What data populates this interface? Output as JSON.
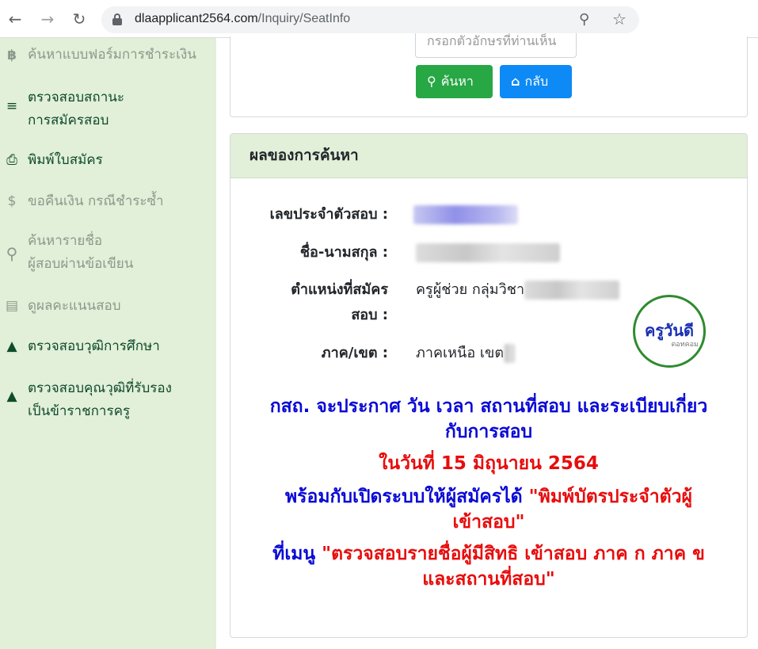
{
  "browser": {
    "url_host": "dlaapplicant2564.com",
    "url_path": "/Inquiry/SeatInfo",
    "back_icon": "arrow-left-icon",
    "forward_icon": "arrow-right-icon",
    "reload_icon": "reload-icon"
  },
  "sidebar": {
    "items": [
      {
        "label": "ค้นหาแบบฟอร์มการชำระเงิน",
        "icon": "baht-icon"
      },
      {
        "label_line1": "ตรวจสอบสถานะ",
        "label_line2": "การสมัครสอบ",
        "icon": "checklist-icon"
      },
      {
        "label": "พิมพ์ใบสมัคร",
        "icon": "print-icon"
      },
      {
        "label": "ขอคืนเงิน กรณีชำระซ้ำ",
        "icon": "refund-icon"
      },
      {
        "label_line1": "ค้นหารายชื่อ",
        "label_line2": "ผู้สอบผ่านข้อเขียน",
        "icon": "search-icon"
      },
      {
        "label": "ดูผลคะแนนสอบ",
        "icon": "scroll-icon"
      },
      {
        "label": "ตรวจสอบวุฒิการศึกษา",
        "icon": "graduation-cap-icon"
      },
      {
        "label_line1": "ตรวจสอบคุณวุฒิที่รับรอง",
        "label_line2": "เป็นข้าราชการครู",
        "icon": "stamp-icon"
      }
    ]
  },
  "search_form": {
    "input_placeholder": "กรอกตัวอักษรที่ท่านเห็น",
    "search_label": "ค้นหา",
    "back_label": "กลับ"
  },
  "result": {
    "header": "ผลของการค้นหา",
    "fields": {
      "exam_id_label": "เลขประจำตัวสอบ :",
      "name_label": "ชื่อ-นามสกุล :",
      "position_label_line1": "ตำแหน่งที่สมัคร",
      "position_label_line2": "สอบ :",
      "position_value": "ครูผู้ช่วย กลุ่มวิชา",
      "region_label": "ภาค/เขต :",
      "region_value": "ภาคเหนือ เขต"
    },
    "logo": {
      "main": "ครูวันดี",
      "sub": "ดอทคอม"
    },
    "notice": {
      "line1": "กสถ. จะประกาศ วัน เวลา สถานที่สอบ และระเบียบเกี่ยว",
      "line2": "กับการสอบ",
      "date_line": "ในวันที่ 15 มิถุนายน 2564",
      "line3_blue": "พร้อมกับเปิดระบบให้ผู้สมัครได้ ",
      "line3_red": "\"พิมพ์บัตรประจำตัวผู้",
      "line4_red": "เข้าสอบ\"",
      "line5_blue": "ที่เมนู ",
      "line5_red": "\"ตรวจสอบรายชื่อผู้มีสิทธิ เข้าสอบ ภาค ก ภาค ข",
      "line6_red": "และสถานที่สอบ\""
    }
  },
  "colors": {
    "sidebar_bg": "#e2efd9",
    "search_button": "#28a745",
    "back_button": "#0d8af5",
    "notice_blue": "#0a0ad6",
    "notice_red": "#e80c0c"
  }
}
